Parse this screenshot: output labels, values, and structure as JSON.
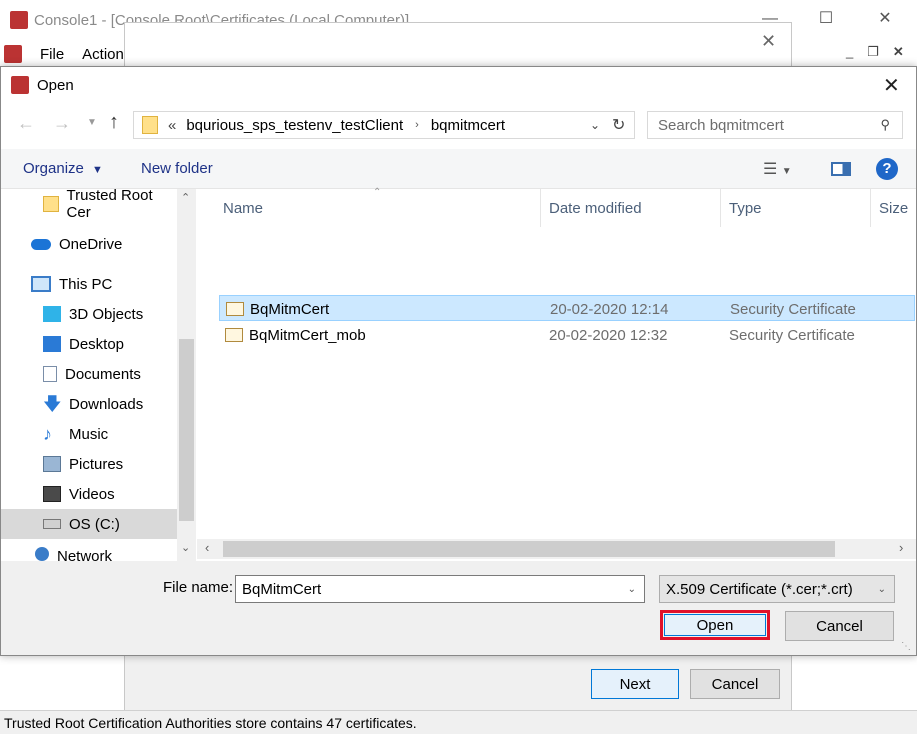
{
  "console": {
    "title": "Console1 - [Console Root\\Certificates (Local Computer)]",
    "menu": [
      "File",
      "Action"
    ],
    "statusbar": "Trusted Root Certification Authorities store contains 47 certificates."
  },
  "wizard": {
    "next_label": "Next",
    "cancel_label": "Cancel"
  },
  "dialog": {
    "title": "Open",
    "breadcrumb_prefix": "«",
    "breadcrumb": [
      "bqurious_sps_testenv_testClient",
      "bqmitmcert"
    ],
    "search_placeholder": "Search bqmitmcert",
    "toolbar": {
      "organize": "Organize",
      "new_folder": "New folder"
    },
    "nav": [
      {
        "label": "Trusted Root Cer",
        "icon": "folder-icon"
      },
      {
        "label": "OneDrive",
        "icon": "cloud-icon"
      },
      {
        "label": "This PC",
        "icon": "computer-icon"
      },
      {
        "label": "3D Objects",
        "icon": "cube-icon"
      },
      {
        "label": "Desktop",
        "icon": "desktop-icon"
      },
      {
        "label": "Documents",
        "icon": "document-icon"
      },
      {
        "label": "Downloads",
        "icon": "download-icon"
      },
      {
        "label": "Music",
        "icon": "music-icon"
      },
      {
        "label": "Pictures",
        "icon": "pictures-icon"
      },
      {
        "label": "Videos",
        "icon": "videos-icon"
      },
      {
        "label": "OS (C:)",
        "icon": "drive-icon"
      },
      {
        "label": "Network",
        "icon": "network-icon"
      }
    ],
    "columns": [
      "Name",
      "Date modified",
      "Type",
      "Size"
    ],
    "files": [
      {
        "name": "BqMitmCert",
        "date": "20-02-2020 12:14",
        "type": "Security Certificate"
      },
      {
        "name": "BqMitmCert_mob",
        "date": "20-02-2020 12:32",
        "type": "Security Certificate"
      }
    ],
    "filename_label": "File name:",
    "filename_value": "BqMitmCert",
    "filter_value": "X.509 Certificate (*.cer;*.crt)",
    "open_label": "Open",
    "cancel_label": "Cancel"
  },
  "colors": {
    "accent": "#0078d7",
    "selection": "#cce8ff",
    "highlight_box": "#e0102a"
  }
}
